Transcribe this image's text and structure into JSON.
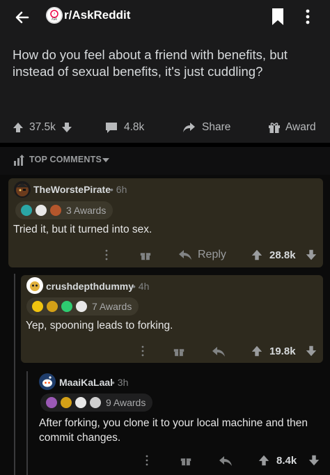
{
  "header": {
    "subreddit": "r/AskReddit",
    "back_icon": "arrow-left-icon",
    "bookmark_icon": "bookmark-icon",
    "more_icon": "kebab-icon"
  },
  "post": {
    "title": "How do you feel about a friend with benefits, but instead of sexual benefits, it's just cuddling?",
    "upvotes": "37.5k",
    "comments": "4.8k",
    "share_label": "Share",
    "award_label": "Award"
  },
  "sort": {
    "label": "TOP COMMENTS"
  },
  "comments": [
    {
      "author": "TheWorstePirate",
      "time": "• 6h",
      "awards": "3 Awards",
      "text": "Tried it, but it turned into sex.",
      "reply_label": "Reply",
      "score": "28.8k"
    },
    {
      "author": "crushdepthdummy",
      "time": "• 4h",
      "awards": "7 Awards",
      "text": "Yep, spooning leads to forking.",
      "score": "19.8k"
    },
    {
      "author": "MaaiKaLaal",
      "time": "• 3h",
      "awards": "9 Awards",
      "text": "After forking, you clone it to your local machine and then commit changes.",
      "score": "8.4k"
    }
  ],
  "colors": {
    "background": "#0b0b0b",
    "surface": "#1a1a1b",
    "highlight": "#2e2a1e",
    "text": "#d7dadc",
    "muted": "#818384"
  }
}
